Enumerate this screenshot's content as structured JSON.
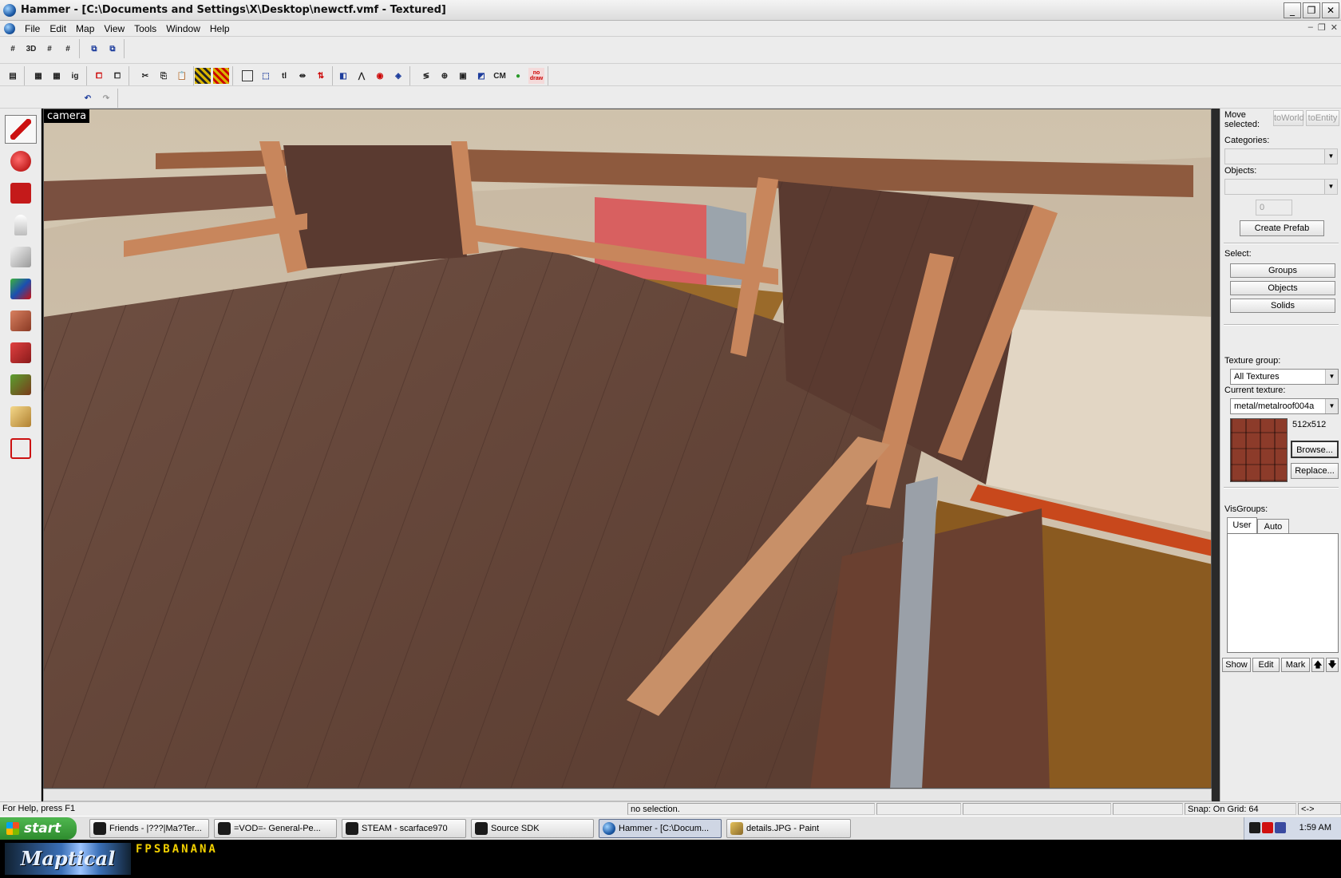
{
  "window": {
    "title": "Hammer - [C:\\Documents and Settings\\X\\Desktop\\newctf.vmf - Textured]",
    "minimize": "_",
    "maximize": "❐",
    "close": "✕"
  },
  "menu": {
    "items": [
      "File",
      "Edit",
      "Map",
      "View",
      "Tools",
      "Window",
      "Help"
    ],
    "mdi_minimize": "–",
    "mdi_restore": "❐",
    "mdi_close": "✕"
  },
  "toolbar": {
    "labels": [
      "3D",
      "tl",
      "CM",
      "no draw"
    ]
  },
  "viewport": {
    "label": "camera"
  },
  "side_panel": {
    "move_selected": "Move selected:",
    "to_world": "toWorld",
    "to_entity": "toEntity",
    "categories_label": "Categories:",
    "categories_value": "",
    "objects_label": "Objects:",
    "objects_value": "",
    "spin_value": "0",
    "create_prefab": "Create Prefab",
    "select_label": "Select:",
    "select_groups": "Groups",
    "select_objects": "Objects",
    "select_solids": "Solids",
    "texture_group_label": "Texture group:",
    "texture_group_value": "All Textures",
    "current_texture_label": "Current texture:",
    "current_texture_value": "metal/metalroof004a",
    "texture_size": "512x512",
    "browse": "Browse...",
    "replace": "Replace...",
    "visgroups_label": "VisGroups:",
    "tab_user": "User",
    "tab_auto": "Auto",
    "show": "Show",
    "edit": "Edit",
    "mark": "Mark",
    "up": "🡅",
    "down": "🡇"
  },
  "statusbar": {
    "help": "For Help, press F1",
    "selection": "no selection.",
    "snap": "Snap: On Grid: 64",
    "arrows": "<->"
  },
  "taskbar": {
    "start": "start",
    "items": [
      "Friends - |???|Ma?Ter...",
      "=VOD=- General-Pe...",
      "STEAM - scarface970",
      "Source SDK",
      "Hammer - [C:\\Docum...",
      "details.JPG - Paint"
    ],
    "clock": "1:59 AM"
  },
  "banner": {
    "logo": "Maptical",
    "site": "FPSBANANA"
  }
}
